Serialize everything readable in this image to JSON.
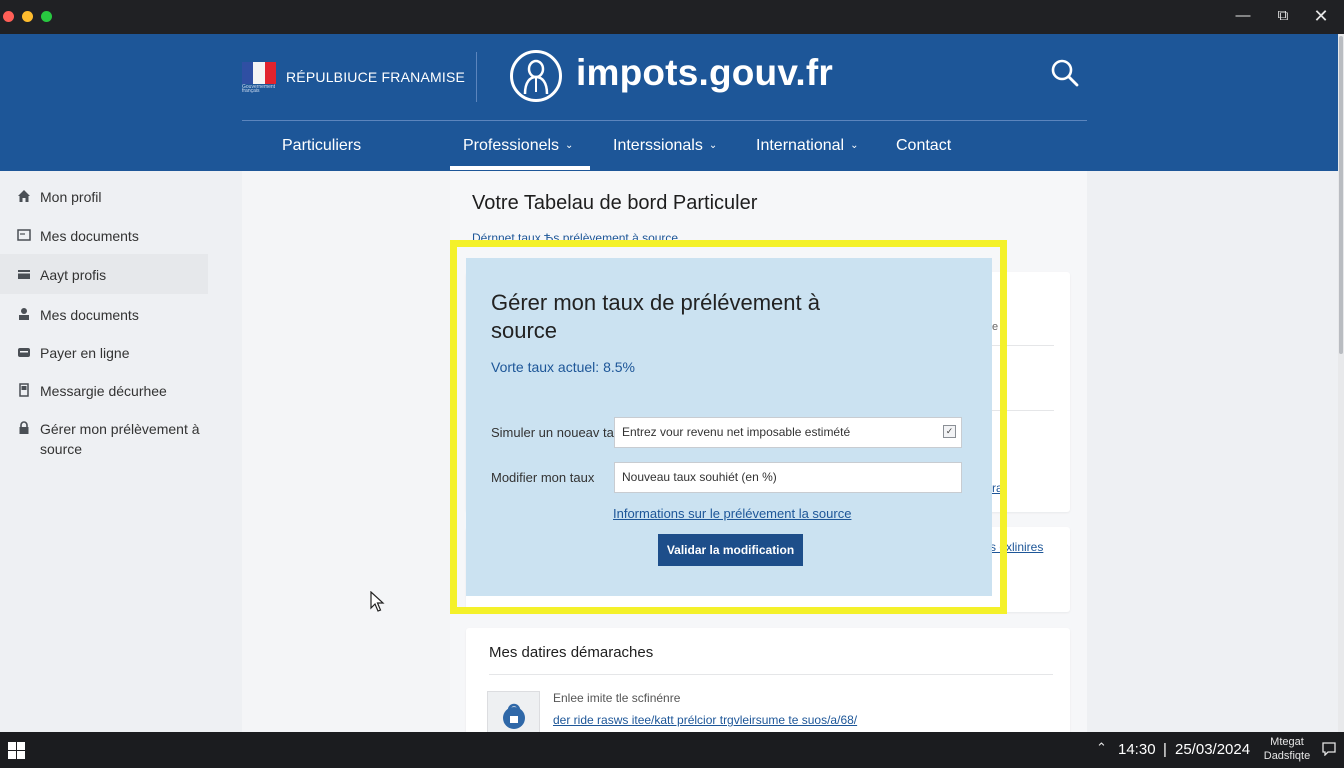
{
  "header": {
    "republique": "RÉPULBIUCE FRANAMISE",
    "flag_caption": "Gouvernement français",
    "site_name": "impots.gouv.fr"
  },
  "nav": {
    "items": [
      {
        "label": "Particuliers",
        "dropdown": false
      },
      {
        "label": "Professionels",
        "dropdown": true
      },
      {
        "label": "Interssionals",
        "dropdown": true
      },
      {
        "label": "International",
        "dropdown": true
      },
      {
        "label": "Contact",
        "dropdown": false
      }
    ]
  },
  "sidebar": {
    "items": [
      {
        "label": "Mon profil",
        "icon": "home-icon"
      },
      {
        "label": "Mes documents",
        "icon": "folder-icon"
      },
      {
        "label": "Aayt profis",
        "icon": "card-icon"
      },
      {
        "label": "Mes documents",
        "icon": "people-icon"
      },
      {
        "label": "Payer en ligne",
        "icon": "wallet-icon"
      },
      {
        "label": "Messargie décurhee",
        "icon": "phone-icon"
      },
      {
        "label": "Gérer mon prélèvement à source",
        "icon": "lock-icon"
      }
    ]
  },
  "main": {
    "title": "Votre Tabelau de bord Particuler",
    "crumb_link": "Dérnnet taux Ѣs prélèvement à source",
    "card1_frag": "e",
    "card1_link": "ra/",
    "card2_link": "s oxlinires",
    "bottom_title": "Mes datires démaraches",
    "doc_line1": "Enlee imite tle scfinénre",
    "doc_line2": "der ride rasws itee/katt prélcior trgvleirsume te suos/a/68/"
  },
  "panel": {
    "title": "Gérer mon taux de prélévement à source",
    "current_rate": "Vorte taux actuel: 8.5%",
    "simulate_label": "Simuler un noueav taux",
    "simulate_placeholder": "Entrez vour revenu net imposable estimété",
    "modify_label": "Modifier mon taux",
    "modify_placeholder": "Nouveau taux souhiét (en %)",
    "info_link": "Informations sur le prélévement la source",
    "validate_button": "Validar la modification"
  },
  "taskbar": {
    "time": "14:30",
    "separator": "|",
    "date": "25/03/2024",
    "tray_line1": "Mtegat",
    "tray_line2": "Dadsfiqte"
  },
  "colors": {
    "brand_blue": "#1d5698",
    "highlight": "#f4f12a",
    "panel_bg": "#cbe2f1",
    "button": "#1d4e8a"
  }
}
